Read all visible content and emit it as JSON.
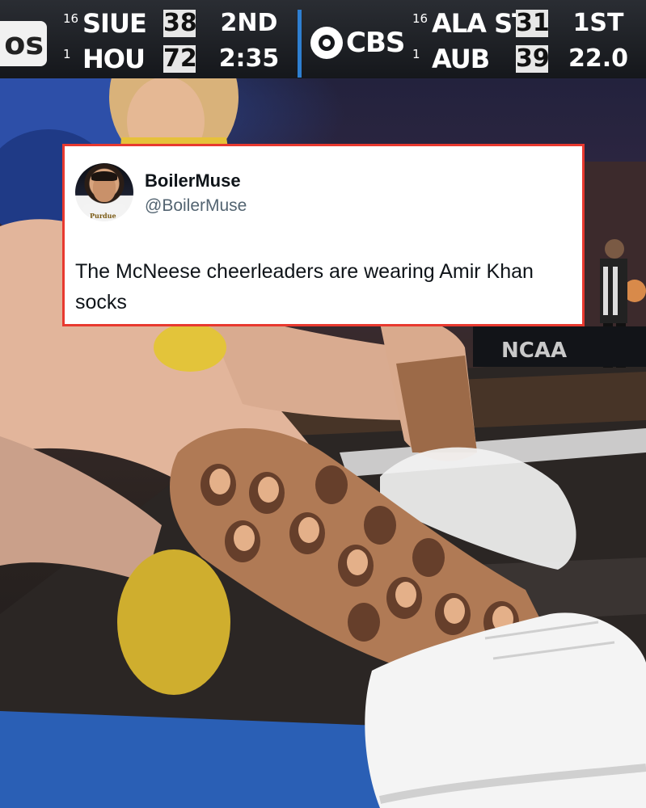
{
  "scoreboard": {
    "network": "os",
    "broadcaster": "CBS",
    "games": [
      {
        "teams": [
          {
            "seed": "16",
            "name": "SIUE",
            "score": "38"
          },
          {
            "seed": "1",
            "name": "HOU",
            "score": "72"
          }
        ],
        "period": "2ND",
        "clock": "2:35"
      },
      {
        "teams": [
          {
            "seed": "16",
            "name": "ALA ST",
            "score": "31"
          },
          {
            "seed": "1",
            "name": "AUB",
            "score": "39"
          }
        ],
        "period": "1ST",
        "clock": "22.0"
      }
    ]
  },
  "tweet": {
    "display_name": "BoilerMuse",
    "handle": "@BoilerMuse",
    "text": "The McNeese cheerleaders are wearing Amir Khan socks",
    "avatar_jersey_text": "Purdue"
  },
  "background": {
    "banner_text": "NCAA"
  },
  "colors": {
    "tweet_border": "#e8392f",
    "divider": "#2e7fd1",
    "score_box": "#e7e7e7"
  }
}
